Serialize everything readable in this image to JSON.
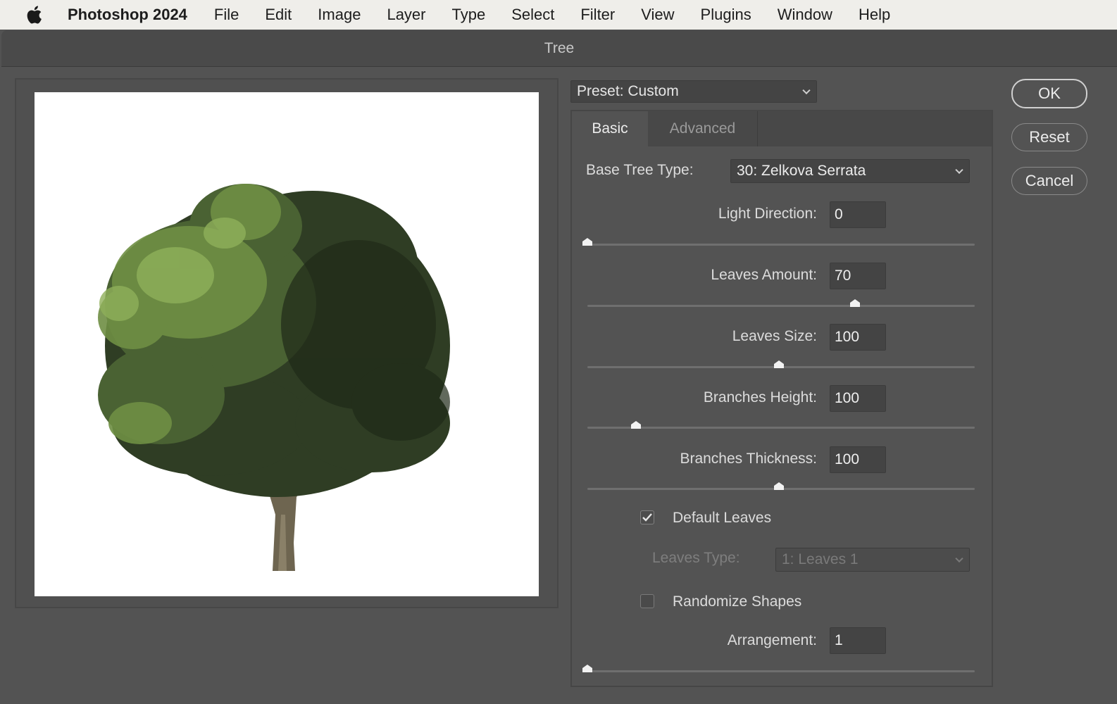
{
  "menubar": {
    "app_name": "Photoshop 2024",
    "items": [
      "File",
      "Edit",
      "Image",
      "Layer",
      "Type",
      "Select",
      "Filter",
      "View",
      "Plugins",
      "Window",
      "Help"
    ],
    "icon": "apple-logo-icon"
  },
  "dialog": {
    "title": "Tree",
    "preset_label": "Preset: Custom",
    "tabs": [
      {
        "label": "Basic",
        "active": true
      },
      {
        "label": "Advanced",
        "active": false
      }
    ],
    "base_tree_type": {
      "label": "Base Tree Type:",
      "value": "30: Zelkova Serrata"
    },
    "sliders": [
      {
        "label": "Light Direction:",
        "value": "0",
        "fraction": 0.0
      },
      {
        "label": "Leaves Amount:",
        "value": "70",
        "fraction": 0.69
      },
      {
        "label": "Leaves Size:",
        "value": "100",
        "fraction": 0.495
      },
      {
        "label": "Branches Height:",
        "value": "100",
        "fraction": 0.125
      },
      {
        "label": "Branches Thickness:",
        "value": "100",
        "fraction": 0.495
      }
    ],
    "default_leaves": {
      "label": "Default Leaves",
      "checked": true
    },
    "leaves_type": {
      "label": "Leaves Type:",
      "value": "1: Leaves 1",
      "disabled": true
    },
    "randomize_shapes": {
      "label": "Randomize Shapes",
      "checked": false
    },
    "arrangement": {
      "label": "Arrangement:",
      "value": "1",
      "fraction": 0.0
    },
    "buttons": {
      "ok": "OK",
      "reset": "Reset",
      "cancel": "Cancel"
    }
  },
  "colors": {
    "panel_bg": "#535353",
    "field_bg": "#444444",
    "text": "#e4e4e4",
    "menubar_bg": "#efeeea"
  }
}
